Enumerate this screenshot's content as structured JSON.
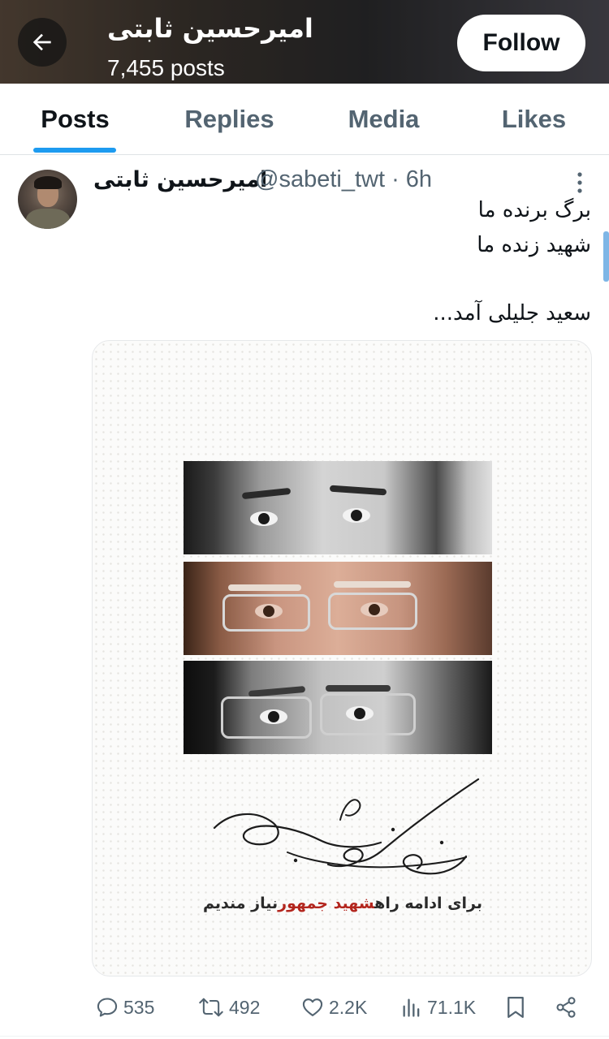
{
  "header": {
    "name": "امیرحسین ثابتی",
    "posts_count": "7,455 posts",
    "follow_label": "Follow"
  },
  "tabs": [
    {
      "label": "Posts",
      "active": true
    },
    {
      "label": "Replies",
      "active": false
    },
    {
      "label": "Media",
      "active": false
    },
    {
      "label": "Likes",
      "active": false
    }
  ],
  "post": {
    "author_name": "امیرحسین ثابتی",
    "handle_time": "@sabeti_twt · 6h",
    "lines": [
      "برگ برنده ما",
      "شهید زنده ما",
      "سعید جلیلی آمد..."
    ],
    "poster": {
      "pre": "برای ادامه راه",
      "highlight": "شهید جمهور",
      "post": "نیاز مندیم"
    },
    "stats": {
      "replies": "535",
      "reposts": "492",
      "likes": "2.2K",
      "views": "71.1K"
    }
  },
  "colors": {
    "accent": "#1d9bf0",
    "text_primary": "#0f1419",
    "text_secondary": "#536471"
  }
}
